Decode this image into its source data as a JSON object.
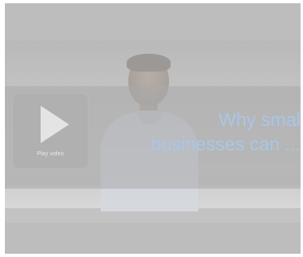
{
  "video": {
    "play_label": "Play video",
    "title_line_1": "Why smal",
    "title_line_2": "businesses can ..."
  },
  "colors": {
    "overlay_gray": "#bdbdbd",
    "title_blue": "#a9c6e8",
    "play_icon": "#e4e4e4"
  },
  "icons": {
    "play": "play-icon"
  }
}
